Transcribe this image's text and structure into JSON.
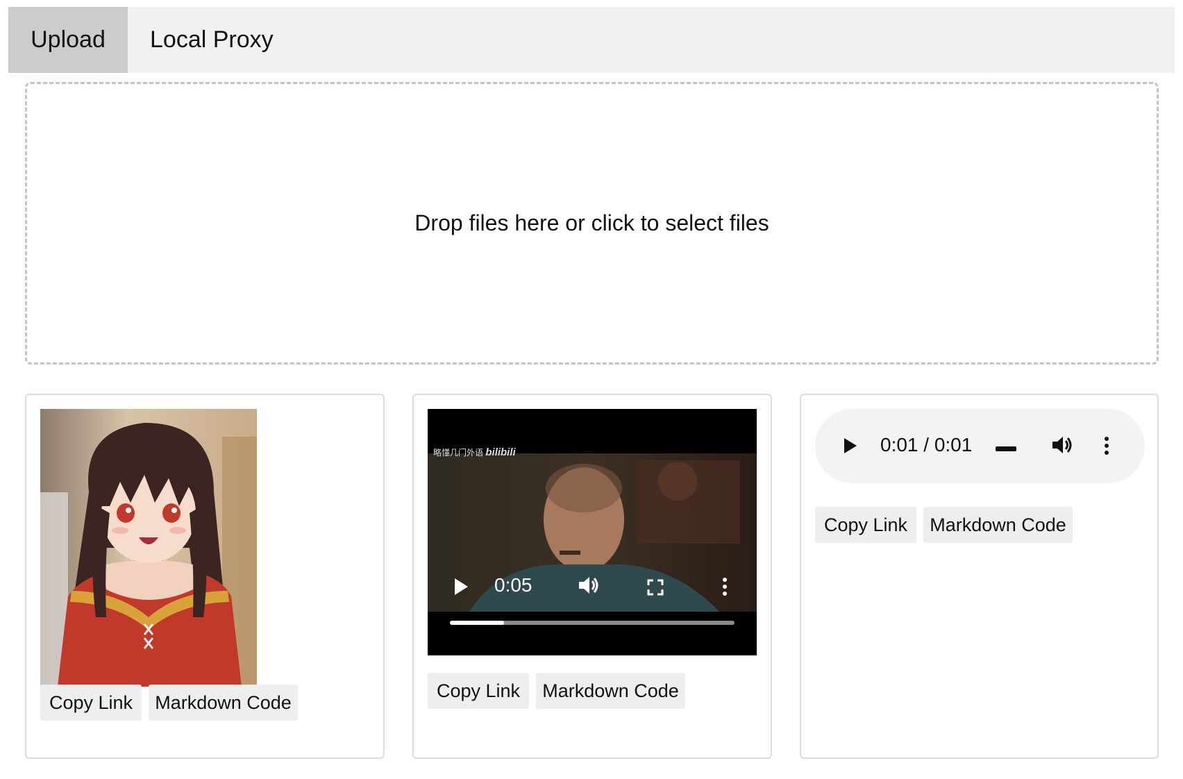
{
  "tabs": [
    {
      "label": "Upload",
      "active": true
    },
    {
      "label": "Local Proxy",
      "active": false
    }
  ],
  "dropzone": {
    "text": "Drop files here or click to select files"
  },
  "cards": {
    "image": {
      "copy_link": "Copy Link",
      "markdown_code": "Markdown Code"
    },
    "video": {
      "watermark_text": "略懂几门外语",
      "watermark_brand": "bilibili",
      "time": "0:05",
      "progress": 0.19,
      "copy_link": "Copy Link",
      "markdown_code": "Markdown Code"
    },
    "audio": {
      "time": "0:01 / 0:01",
      "copy_link": "Copy Link",
      "markdown_code": "Markdown Code"
    }
  },
  "colors": {
    "tab_active": "#cccccc",
    "tab_bar": "#f1f1f1",
    "button_bg": "#eeeeee",
    "audio_bg": "#f1f3f4"
  },
  "icons": [
    "play-icon",
    "volume-icon",
    "fullscreen-icon",
    "more-vert-icon",
    "minus-icon"
  ]
}
